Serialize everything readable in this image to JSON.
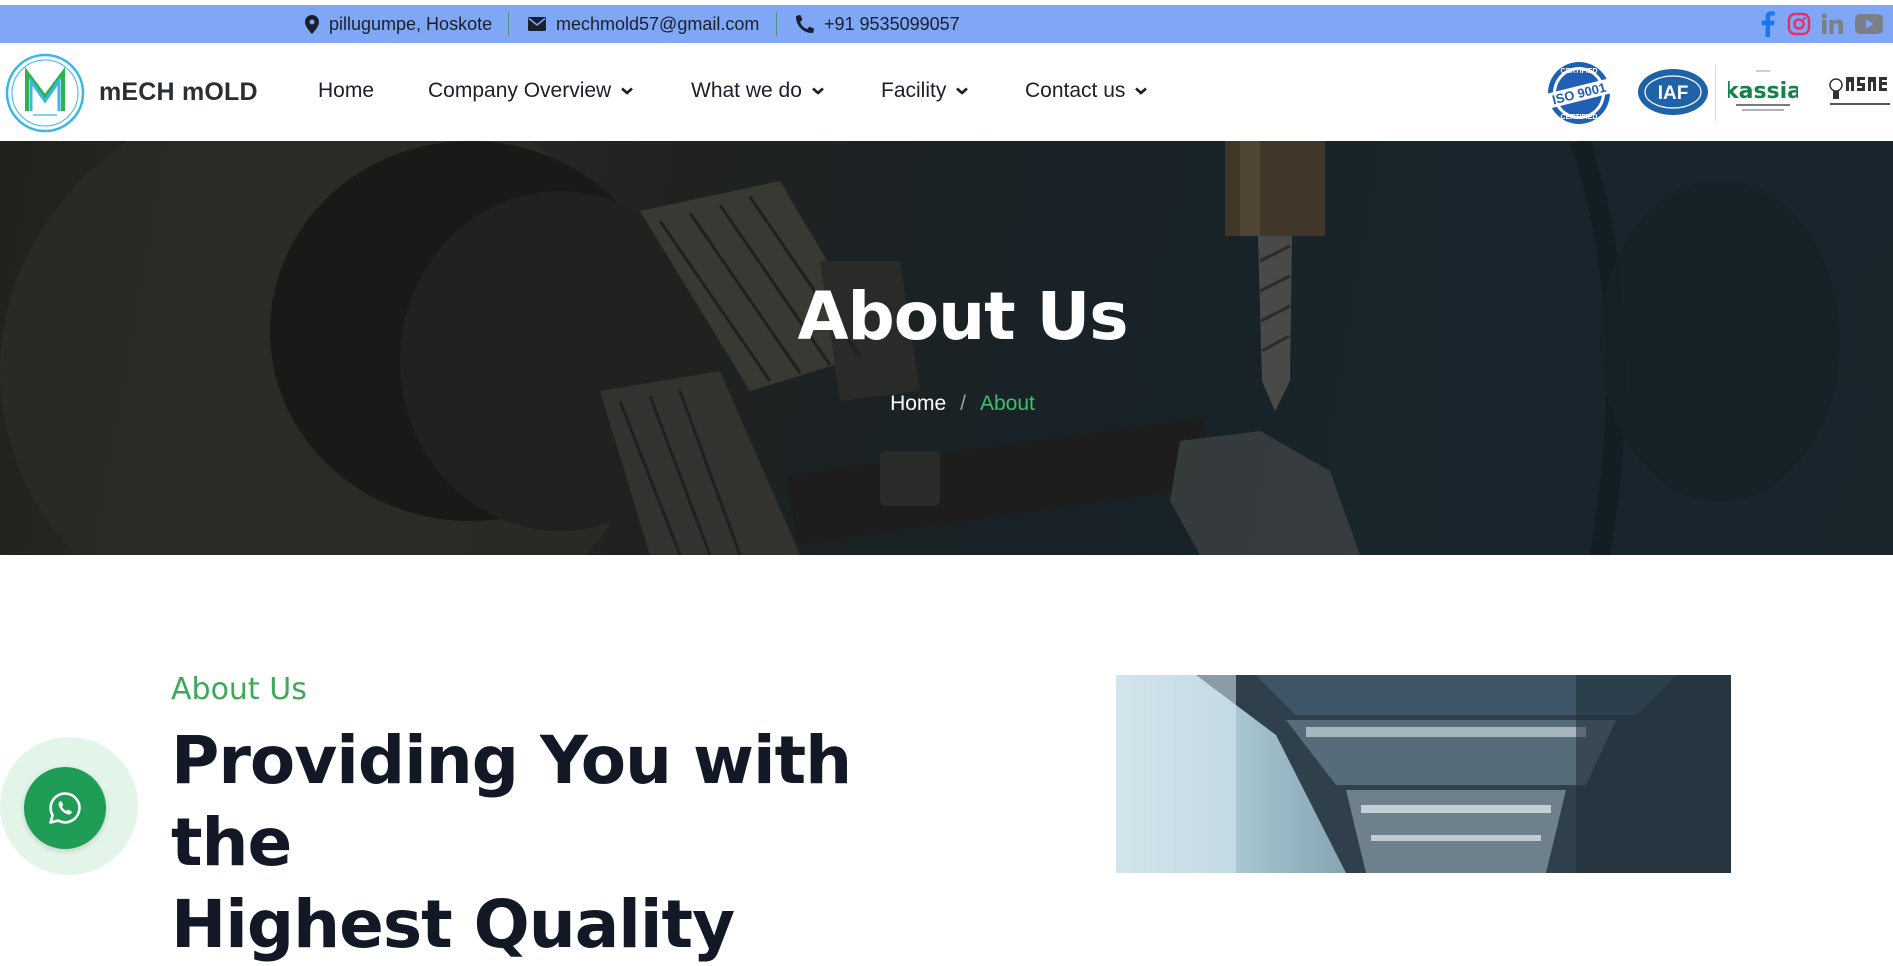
{
  "topbar": {
    "address": "pillugumpe, Hoskote",
    "email": "mechmold57@gmail.com",
    "phone": "+91 9535099057",
    "social_icons": [
      "facebook-icon",
      "instagram-icon",
      "linkedin-icon",
      "youtube-icon"
    ]
  },
  "header": {
    "brand": "mECH mOLD",
    "nav": [
      {
        "label": "Home",
        "has_dropdown": false
      },
      {
        "label": "Company Overview",
        "has_dropdown": true
      },
      {
        "label": "What we do",
        "has_dropdown": true
      },
      {
        "label": "Facility",
        "has_dropdown": true
      },
      {
        "label": "Contact us",
        "has_dropdown": true
      }
    ],
    "certifications": {
      "iso": "ISO 9001",
      "iso_ring": "CERTIFIED",
      "iaf": "IAF",
      "kassia": "kassia"
    }
  },
  "hero": {
    "title": "About Us",
    "breadcrumb": {
      "home": "Home",
      "separator": "/",
      "current": "About"
    }
  },
  "content": {
    "section_label": "About Us",
    "heading_line1": "Providing You with the",
    "heading_line2": "Highest Quality"
  },
  "colors": {
    "topbar_bg": "#7fa7f6",
    "accent_green": "#3fa85a",
    "whatsapp_green": "#1f9d57",
    "heading_dark": "#121826"
  }
}
